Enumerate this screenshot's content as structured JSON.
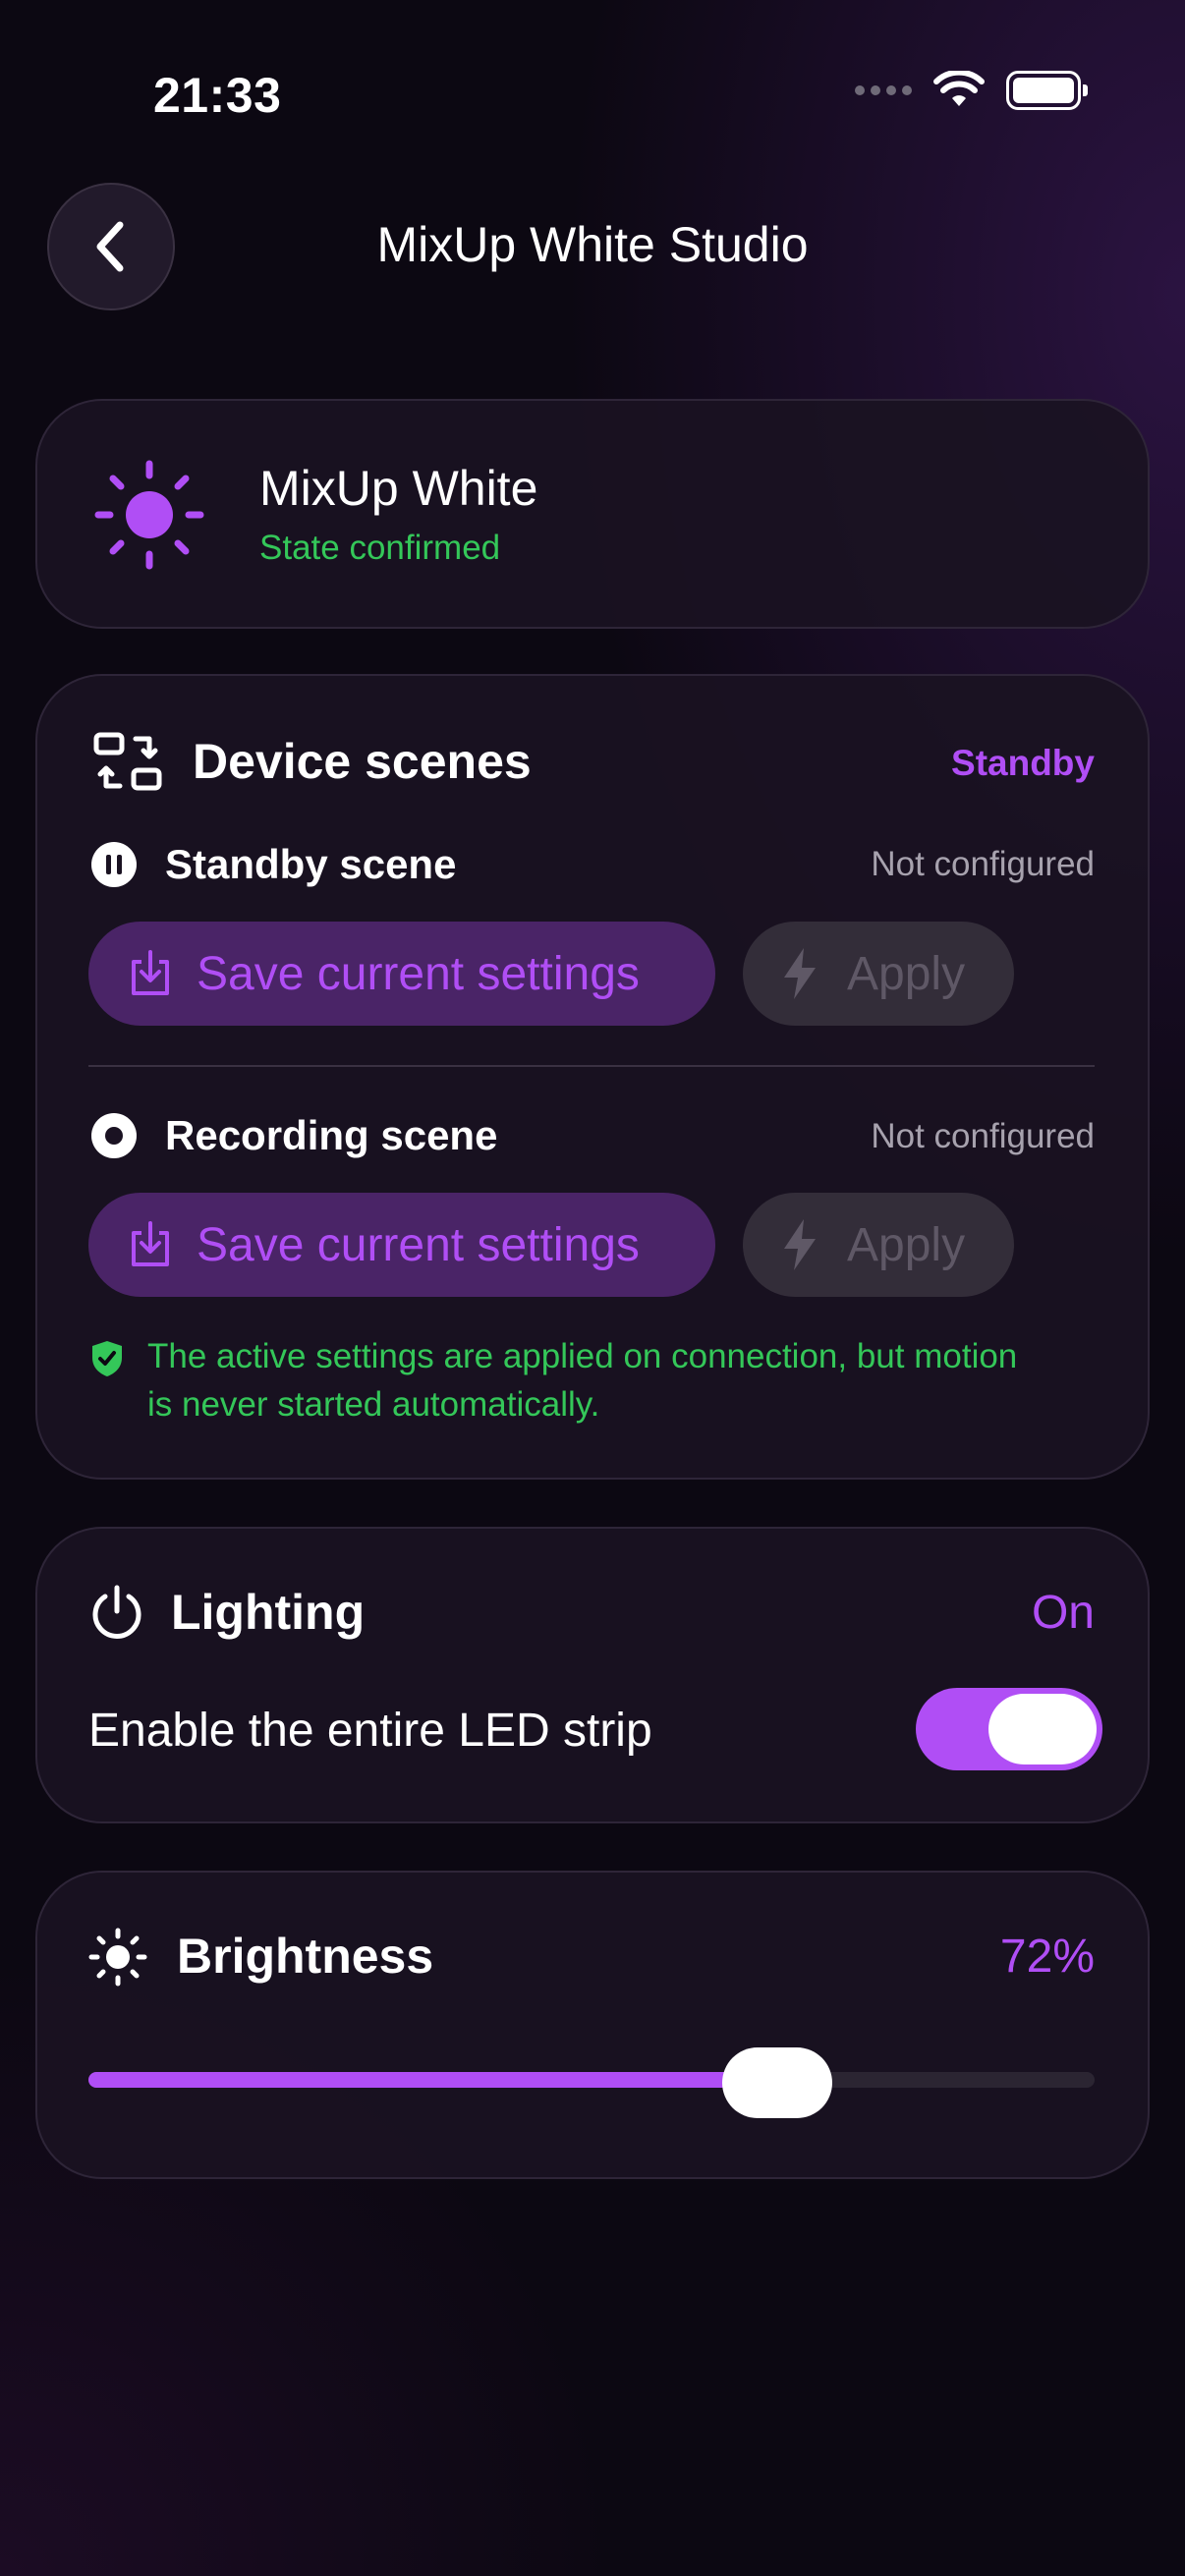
{
  "status_bar": {
    "time": "21:33"
  },
  "nav": {
    "title": "MixUp White Studio",
    "back_icon": "chevron-left-icon"
  },
  "device": {
    "name": "MixUp White",
    "state": "State confirmed",
    "icon": "sun-icon"
  },
  "scenes": {
    "title": "Device scenes",
    "current": "Standby",
    "items": [
      {
        "name": "Standby scene",
        "status": "Not configured",
        "icon": "pause-circle-icon",
        "save_label": "Save current settings",
        "apply_label": "Apply"
      },
      {
        "name": "Recording scene",
        "status": "Not configured",
        "icon": "record-circle-icon",
        "save_label": "Save current settings",
        "apply_label": "Apply"
      }
    ],
    "note": "The active settings are applied on connection, but motion is never started automatically."
  },
  "lighting": {
    "title": "Lighting",
    "state": "On",
    "toggle_label": "Enable the entire LED strip",
    "enabled": true
  },
  "brightness": {
    "title": "Brightness",
    "value_text": "72%",
    "value": 0.72
  },
  "colors": {
    "accent": "#b04ef5",
    "success": "#34c759",
    "background": "#0c0812",
    "card": "#1a1222"
  }
}
